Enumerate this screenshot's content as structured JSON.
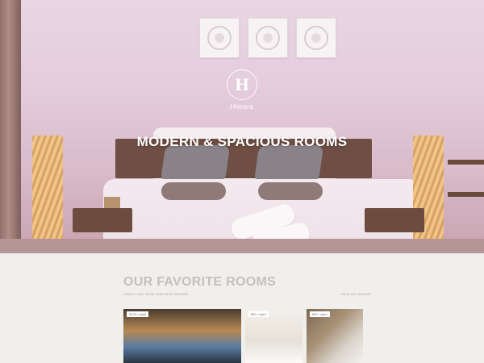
{
  "hero": {
    "brand_letter": "H",
    "brand_name": "Himara",
    "title": "MODERN & SPACIOUS ROOMS"
  },
  "favorites": {
    "title": "OUR FAVORITE ROOMS",
    "subtitle": "CHECK OUT NOW OUR BEST ROOMS",
    "view_all": "VIEW ALL ROOMS",
    "cards": [
      {
        "price": "$129 / night"
      },
      {
        "price": "$89 / night"
      },
      {
        "price": "$99 / night"
      }
    ]
  },
  "icons": {
    "logo": "hotel-logo-icon"
  }
}
